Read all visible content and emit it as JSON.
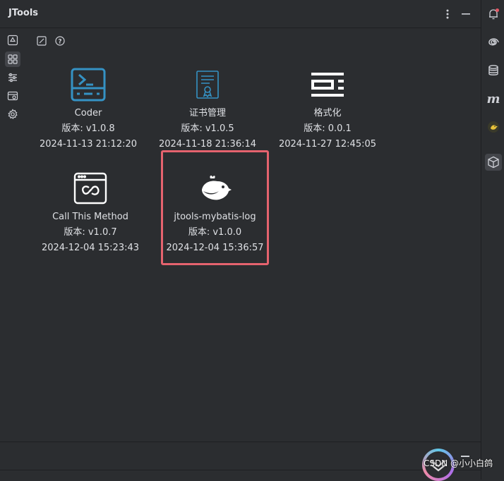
{
  "window": {
    "title": "JTools"
  },
  "colors": {
    "background": "#2b2d30",
    "accent": "#3592c4",
    "selection": "#e5636e",
    "text": "#dfe1e5",
    "notification": "#e55765"
  },
  "titlebar": {
    "icons": [
      "more-vertical-icon",
      "minimize-icon"
    ]
  },
  "left_toolbar": {
    "items": [
      {
        "icon": "recycle-icon",
        "active": false
      },
      {
        "icon": "grid-icon",
        "active": true
      },
      {
        "icon": "sliders-icon",
        "active": false
      },
      {
        "icon": "calendar-icon",
        "active": false
      },
      {
        "icon": "gear-icon",
        "active": false
      }
    ]
  },
  "content_toolbar": {
    "icons": [
      "edit-icon",
      "help-icon"
    ]
  },
  "plugins": [
    {
      "name": "Coder",
      "version": "版本: v1.0.8",
      "date": "2024-11-13 21:12:20",
      "icon": "terminal-icon"
    },
    {
      "name": "证书管理",
      "version": "版本: v1.0.5",
      "date": "2024-11-18 21:36:14",
      "icon": "certificate-icon"
    },
    {
      "name": "格式化",
      "version": "版本: 0.0.1",
      "date": "2024-11-27 12:45:05",
      "icon": "format-icon"
    },
    {
      "name": "Call This Method",
      "version": "版本: v1.0.7",
      "date": "2024-12-04 15:23:43",
      "icon": "link-window-icon"
    },
    {
      "name": "jtools-mybatis-log",
      "version": "版本: v1.0.0",
      "date": "2024-12-04 15:36:57",
      "icon": "bird-icon",
      "selected": true
    }
  ],
  "right_toolbar": {
    "items": [
      {
        "icon": "notification-bell-icon"
      },
      {
        "icon": "swirl-icon"
      },
      {
        "icon": "database-icon"
      },
      {
        "icon": "m-icon"
      },
      {
        "icon": "duck-icon"
      },
      {
        "icon": "cube-icon",
        "active": true
      }
    ]
  },
  "watermark": "CSDN @小小白鸽"
}
